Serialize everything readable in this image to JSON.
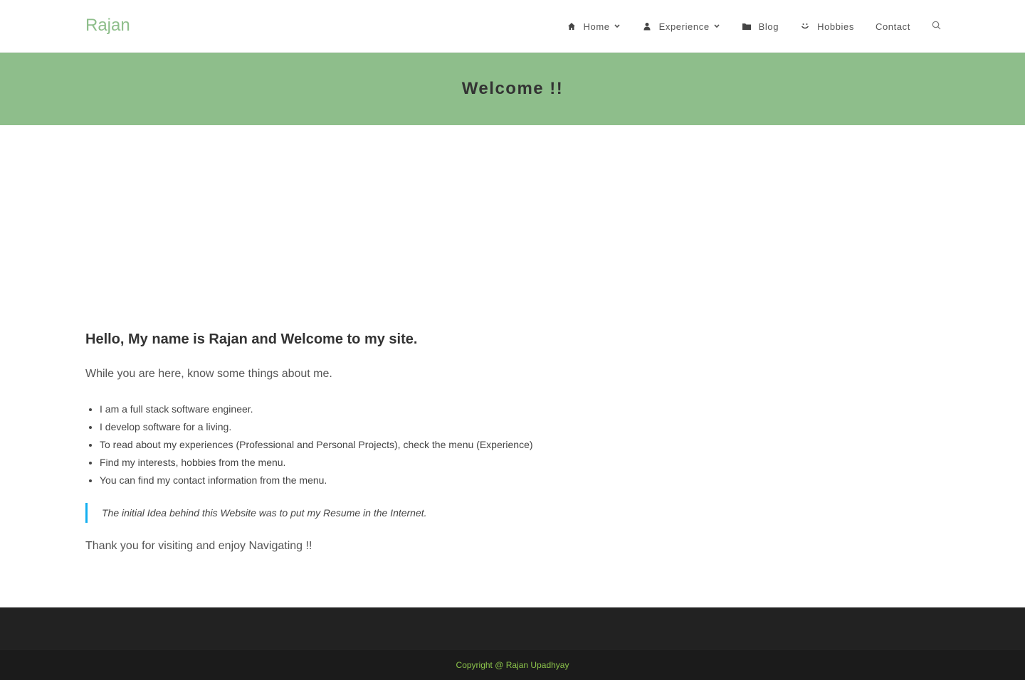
{
  "header": {
    "logo": "Rajan",
    "nav": [
      {
        "label": "Home",
        "icon": "home-icon",
        "has_dropdown": true
      },
      {
        "label": "Experience",
        "icon": "user-icon",
        "has_dropdown": true
      },
      {
        "label": "Blog",
        "icon": "folder-icon",
        "has_dropdown": false
      },
      {
        "label": "Hobbies",
        "icon": "smile-icon",
        "has_dropdown": false
      },
      {
        "label": "Contact",
        "icon": "",
        "has_dropdown": false
      }
    ],
    "search_icon": "search-icon"
  },
  "banner": {
    "title": "Welcome !!"
  },
  "main": {
    "heading": "Hello, My name is Rajan and Welcome to my site.",
    "intro": "While you are here, know some things about me.",
    "facts": [
      "I am a full stack software engineer.",
      "I develop software for a living.",
      "To read about my experiences (Professional and Personal Projects), check the menu (Experience)",
      "Find my interests, hobbies from the menu.",
      "You can find my contact information from the menu."
    ],
    "quote": "The initial Idea behind this Website was to put my Resume in the Internet.",
    "closing": "Thank you for visiting and enjoy Navigating !!"
  },
  "footer": {
    "copyright": "Copyright @ Rajan Upadhyay"
  },
  "colors": {
    "accent": "#8ebe8b",
    "quote_border": "#13aff0",
    "footer_dark": "#222222",
    "footer_text": "#8bc34a"
  }
}
